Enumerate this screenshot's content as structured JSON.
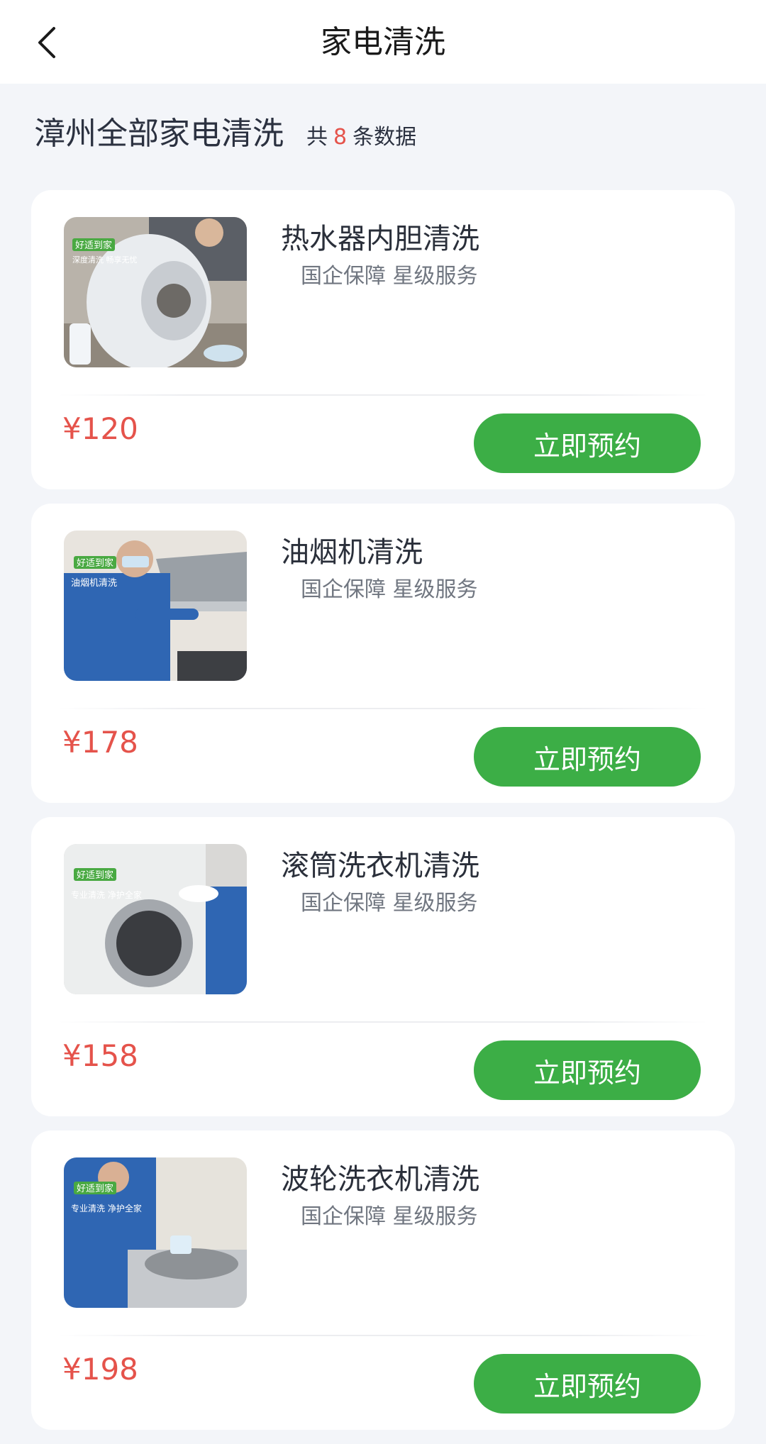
{
  "header": {
    "title": "家电清洗"
  },
  "summary": {
    "title": "漳州全部家电清洗",
    "prefix": "共",
    "count": "8",
    "suffix": "条数据"
  },
  "services": [
    {
      "title": "热水器内胆清洗",
      "tags": "国企保障 星级服务",
      "price": "¥120",
      "button": "立即预约",
      "image_brand": "好适到家",
      "image_slogan": "深度清洗 畅享无忧"
    },
    {
      "title": "油烟机清洗",
      "tags": "国企保障 星级服务",
      "price": "¥178",
      "button": "立即预约",
      "image_brand": "好适到家",
      "image_slogan": "油烟机清洗"
    },
    {
      "title": "滚筒洗衣机清洗",
      "tags": "国企保障 星级服务",
      "price": "¥158",
      "button": "立即预约",
      "image_brand": "好适到家",
      "image_slogan": "专业清洗 净护全家"
    },
    {
      "title": "波轮洗衣机清洗",
      "tags": "国企保障 星级服务",
      "price": "¥198",
      "button": "立即预约",
      "image_brand": "好适到家",
      "image_slogan": "专业清洗 净护全家"
    }
  ],
  "colors": {
    "accent": "#3cae46",
    "price": "#e5534b",
    "background": "#f3f5f9"
  }
}
